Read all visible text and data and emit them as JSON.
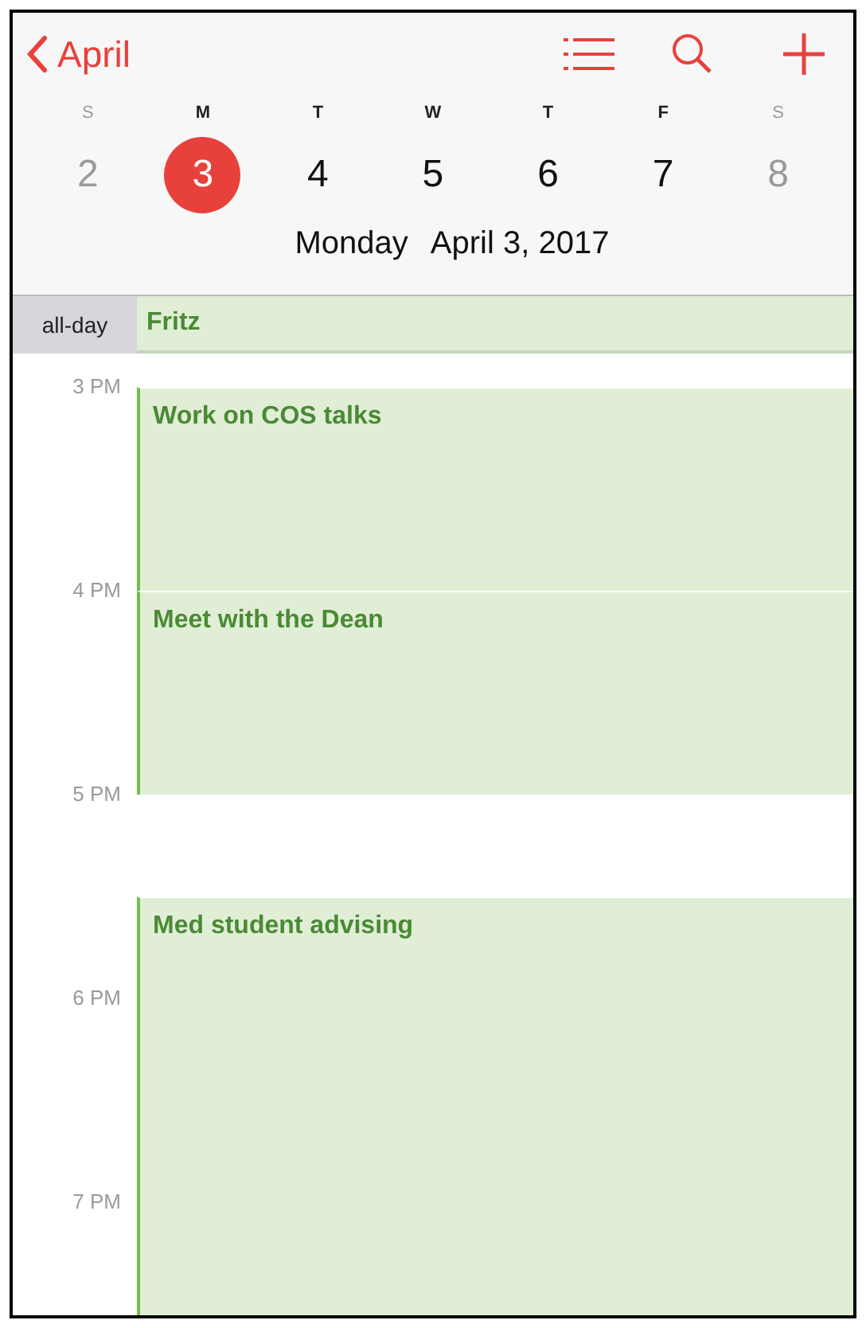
{
  "nav": {
    "back_label": "April"
  },
  "week": [
    {
      "weekday": "S",
      "date": "2",
      "weekend": true,
      "selected": false
    },
    {
      "weekday": "M",
      "date": "3",
      "weekend": false,
      "selected": true
    },
    {
      "weekday": "T",
      "date": "4",
      "weekend": false,
      "selected": false
    },
    {
      "weekday": "W",
      "date": "5",
      "weekend": false,
      "selected": false
    },
    {
      "weekday": "T",
      "date": "6",
      "weekend": false,
      "selected": false
    },
    {
      "weekday": "F",
      "date": "7",
      "weekend": false,
      "selected": false
    },
    {
      "weekday": "S",
      "date": "8",
      "weekend": true,
      "selected": false
    }
  ],
  "day_title": {
    "weekday": "Monday",
    "date": "April 3, 2017"
  },
  "all_day": {
    "label": "all-day",
    "events": [
      {
        "title": "Fritz"
      }
    ]
  },
  "hours": [
    {
      "label": "3 PM",
      "events": [
        {
          "title": "Work on COS talks",
          "kind": "one_hour"
        }
      ]
    },
    {
      "label": "4 PM",
      "events": [
        {
          "title": "Meet with the Dean",
          "kind": "one_hour"
        }
      ]
    },
    {
      "label": "5 PM",
      "events": [
        {
          "title": "Med student advising",
          "kind": "half_past_onward"
        }
      ]
    },
    {
      "label": "6 PM"
    },
    {
      "label": "7 PM"
    }
  ]
}
